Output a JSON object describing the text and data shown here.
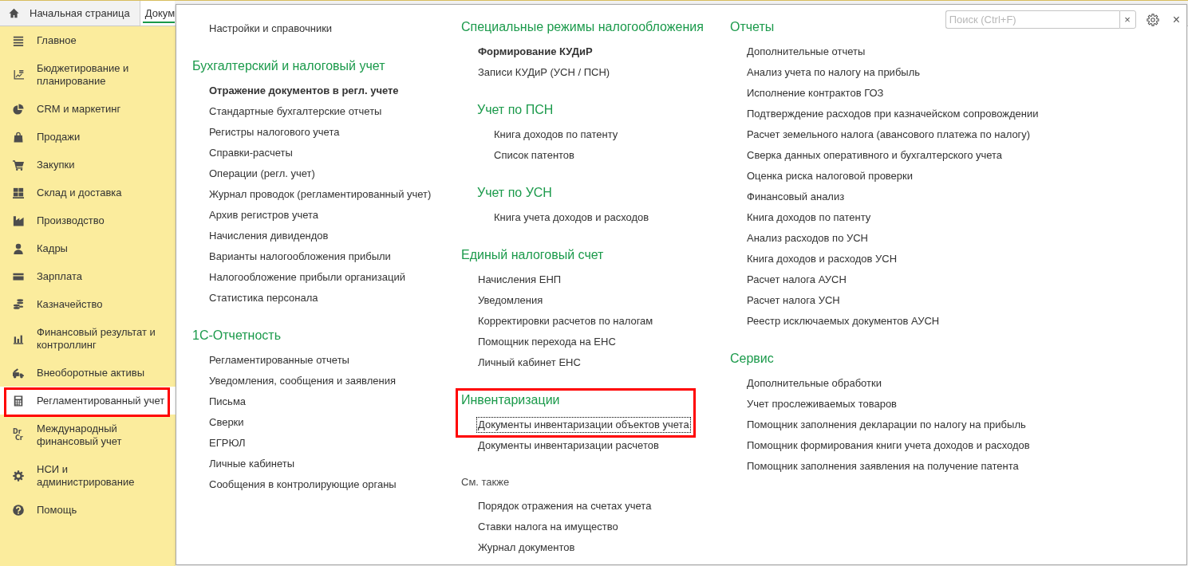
{
  "tabs": [
    {
      "label": "Начальная страница",
      "selected": false
    },
    {
      "label": "Докум",
      "selected": true
    }
  ],
  "sidebar": {
    "items": [
      {
        "label": "Главное",
        "selected": false,
        "annotated": false
      },
      {
        "label": "Бюджетирование и\nпланирование",
        "selected": false,
        "annotated": false
      },
      {
        "label": "CRM и маркетинг",
        "selected": false,
        "annotated": false
      },
      {
        "label": "Продажи",
        "selected": false,
        "annotated": false
      },
      {
        "label": "Закупки",
        "selected": false,
        "annotated": false
      },
      {
        "label": "Склад и доставка",
        "selected": false,
        "annotated": false
      },
      {
        "label": "Производство",
        "selected": false,
        "annotated": false
      },
      {
        "label": "Кадры",
        "selected": false,
        "annotated": false
      },
      {
        "label": "Зарплата",
        "selected": false,
        "annotated": false
      },
      {
        "label": "Казначейство",
        "selected": false,
        "annotated": false
      },
      {
        "label": "Финансовый результат и\nконтроллинг",
        "selected": false,
        "annotated": false
      },
      {
        "label": "Внеоборотные активы",
        "selected": false,
        "annotated": false
      },
      {
        "label": "Регламентированный учет",
        "selected": true,
        "annotated": true
      },
      {
        "label": "Международный\nфинансовый учет",
        "selected": false,
        "annotated": false,
        "icon_text": [
          "Dr",
          "Cr"
        ]
      },
      {
        "label": "НСИ и\nадминистрирование",
        "selected": false,
        "annotated": false
      },
      {
        "label": "Помощь",
        "selected": false,
        "annotated": false
      }
    ]
  },
  "panel": {
    "search": {
      "placeholder": "Поиск (Ctrl+F)",
      "clear": "×"
    },
    "close": "×",
    "columns": [
      {
        "groups": [
          {
            "items": [
              "Настройки и справочники"
            ]
          },
          {
            "heading": "Бухгалтерский и налоговый учет",
            "kind": "section",
            "lead": "Отражение документов в регл. учете",
            "items": [
              "Стандартные бухгалтерские отчеты",
              "Регистры налогового учета",
              "Справки-расчеты",
              "Операции (регл. учет)",
              "Журнал проводок (регламентированный учет)",
              "Архив регистров учета",
              "Начисления дивидендов",
              "Варианты налогообложения прибыли",
              "Налогообложение прибыли организаций",
              "Статистика персонала"
            ]
          },
          {
            "heading": "1С-Отчетность",
            "kind": "section",
            "items": [
              "Регламентированные отчеты",
              "Уведомления, сообщения и заявления",
              "Письма",
              "Сверки",
              "ЕГРЮЛ",
              "Личные кабинеты",
              "Сообщения в контролирующие органы"
            ]
          }
        ]
      },
      {
        "groups": [
          {
            "heading": "Специальные режимы налогообложения",
            "kind": "section",
            "lead": "Формирование КУДиР",
            "items": [
              "Записи КУДиР (УСН / ПСН)"
            ],
            "children": [
              {
                "heading": "Учет по ПСН",
                "kind": "section",
                "items": [
                  "Книга доходов по патенту",
                  "Список патентов"
                ]
              },
              {
                "heading": "Учет по УСН",
                "kind": "section",
                "items": [
                  "Книга учета доходов и расходов"
                ]
              }
            ]
          },
          {
            "heading": "Единый налоговый счет",
            "kind": "section",
            "items": [
              "Начисления ЕНП",
              "Уведомления",
              "Корректировки расчетов по налогам",
              "Помощник перехода на ЕНС",
              "Личный кабинет ЕНС"
            ]
          },
          {
            "heading": "Инвентаризации",
            "kind": "section",
            "annotated": true,
            "items": [
              {
                "label": "Документы инвентаризации объектов учета",
                "focused": true,
                "annotated": true
              },
              {
                "label": "Документы инвентаризации расчетов",
                "focused": false,
                "annotated": false
              }
            ]
          },
          {
            "heading": "См. также",
            "kind": "see_also",
            "items": [
              "Порядок отражения на счетах учета",
              "Ставки налога на имущество",
              "Журнал документов"
            ]
          }
        ]
      },
      {
        "groups": [
          {
            "heading": "Отчеты",
            "kind": "section",
            "items": [
              "Дополнительные отчеты",
              "Анализ учета по налогу на прибыль",
              "Исполнение контрактов ГОЗ",
              "Подтверждение расходов при казначейском сопровождении",
              "Расчет земельного налога (авансового платежа по налогу)",
              "Сверка данных оперативного и бухгалтерского учета",
              "Оценка риска налоговой проверки",
              "Финансовый анализ",
              "Книга доходов по патенту",
              "Анализ расходов по УСН",
              "Книга доходов и расходов УСН",
              "Расчет налога АУСН",
              "Расчет налога УСН",
              "Реестр исключаемых документов АУСН"
            ]
          },
          {
            "heading": "Сервис",
            "kind": "section",
            "items": [
              "Дополнительные обработки",
              "Учет прослеживаемых товаров",
              "Помощник заполнения декларации по налогу на прибыль",
              "Помощник формирования книги учета доходов и расходов",
              "Помощник заполнения заявления на получение патента"
            ]
          }
        ]
      }
    ]
  }
}
